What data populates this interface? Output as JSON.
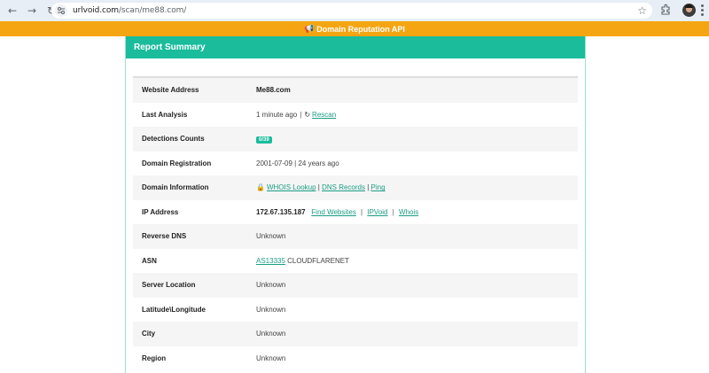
{
  "browser": {
    "url_host": "urlvoid.com",
    "url_path": "/scan/me88.com/"
  },
  "banner": {
    "text": "Domain Reputation API",
    "icon": "megaphone-icon"
  },
  "card": {
    "title": "Report Summary"
  },
  "report": {
    "website_address_label": "Website Address",
    "website_address_value": "Me88.com",
    "last_analysis_label": "Last Analysis",
    "last_analysis_value": "1 minute ago",
    "last_analysis_sep": "|",
    "rescan_label": "Rescan",
    "detections_label": "Detections Counts",
    "detections_value": "0/39",
    "domain_registration_label": "Domain Registration",
    "domain_registration_value": "2001-07-09 | 24 years ago",
    "domain_information_label": "Domain Information",
    "whois_lookup_label": "WHOIS Lookup",
    "dns_records_label": "DNS Records",
    "ping_label": "Ping",
    "ip_address_label": "IP Address",
    "ip_address_value": "172.67.135.187",
    "find_websites_label": "Find Websites",
    "ipvoid_label": "IPVoid",
    "whois_label": "Whois",
    "reverse_dns_label": "Reverse DNS",
    "reverse_dns_value": "Unknown",
    "asn_label": "ASN",
    "asn_link": "AS13335",
    "asn_name": "CLOUDFLARENET",
    "server_location_label": "Server Location",
    "server_location_value": "Unknown",
    "lat_long_label": "Latitude\\Longitude",
    "lat_long_value": "Unknown",
    "city_label": "City",
    "city_value": "Unknown",
    "region_label": "Region",
    "region_value": "Unknown"
  },
  "colors": {
    "accent": "#1abc9c",
    "banner": "#f5a511",
    "link": "#1a9e86"
  }
}
